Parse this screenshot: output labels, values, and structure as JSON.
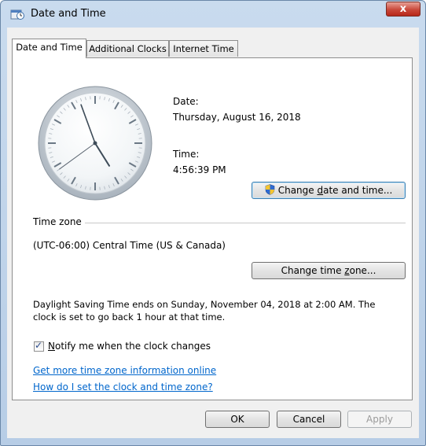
{
  "window": {
    "title": "Date and Time",
    "close_label": "x"
  },
  "tabs": [
    {
      "label": "Date and Time",
      "active": true
    },
    {
      "label": "Additional Clocks",
      "active": false
    },
    {
      "label": "Internet Time",
      "active": false
    }
  ],
  "clock": {
    "hour": 4,
    "minute": 56,
    "second": 39
  },
  "date_section": {
    "date_label": "Date:",
    "date_value": "Thursday, August 16, 2018",
    "time_label": "Time:",
    "time_value": "4:56:39 PM",
    "change_button_pre": "Change ",
    "change_button_key": "d",
    "change_button_post": "ate and time..."
  },
  "timezone": {
    "heading": "Time zone",
    "value": "(UTC-06:00) Central Time (US & Canada)",
    "change_button_pre": "Change time ",
    "change_button_key": "z",
    "change_button_post": "one..."
  },
  "dst": {
    "line1": "Daylight Saving Time ends on Sunday, November 04, 2018 at 2:00 AM. The",
    "line2": "clock is set to go back 1 hour at that time."
  },
  "notify": {
    "checked": true,
    "label_key": "N",
    "label_rest": "otify me when the clock changes"
  },
  "links": {
    "more_info": "Get more time zone information online",
    "how_to": "How do I set the clock and time zone?"
  },
  "buttons": {
    "ok": "OK",
    "cancel": "Cancel",
    "apply": "Apply"
  },
  "colors": {
    "link": "#0066cc",
    "close_button": "#c9483a"
  }
}
